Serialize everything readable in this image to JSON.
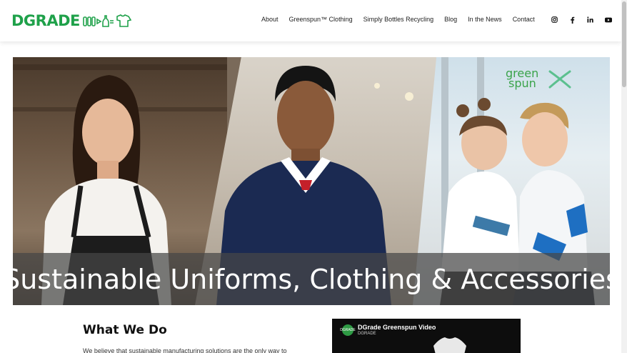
{
  "header": {
    "logo_text": "DGRADE",
    "nav": [
      "About",
      "Greenspun™ Clothing",
      "Simply Bottles Recycling",
      "Blog",
      "In the News",
      "Contact"
    ],
    "social_icons": [
      "instagram-icon",
      "facebook-icon",
      "linkedin-icon",
      "youtube-icon"
    ]
  },
  "hero": {
    "caption": "Sustainable Uniforms, Clothing & Accessories",
    "badge_line1": "green",
    "badge_line2": "spun"
  },
  "what_we_do": {
    "heading": "What We Do",
    "text": "We believe that sustainable manufacturing solutions are the only way to"
  },
  "video": {
    "title": "DGrade Greenspun Video",
    "channel": "DGRADE",
    "avatar_text": "DGRADE"
  },
  "colors": {
    "brand_green": "#1fa14a",
    "caption_bar": "#464646"
  }
}
